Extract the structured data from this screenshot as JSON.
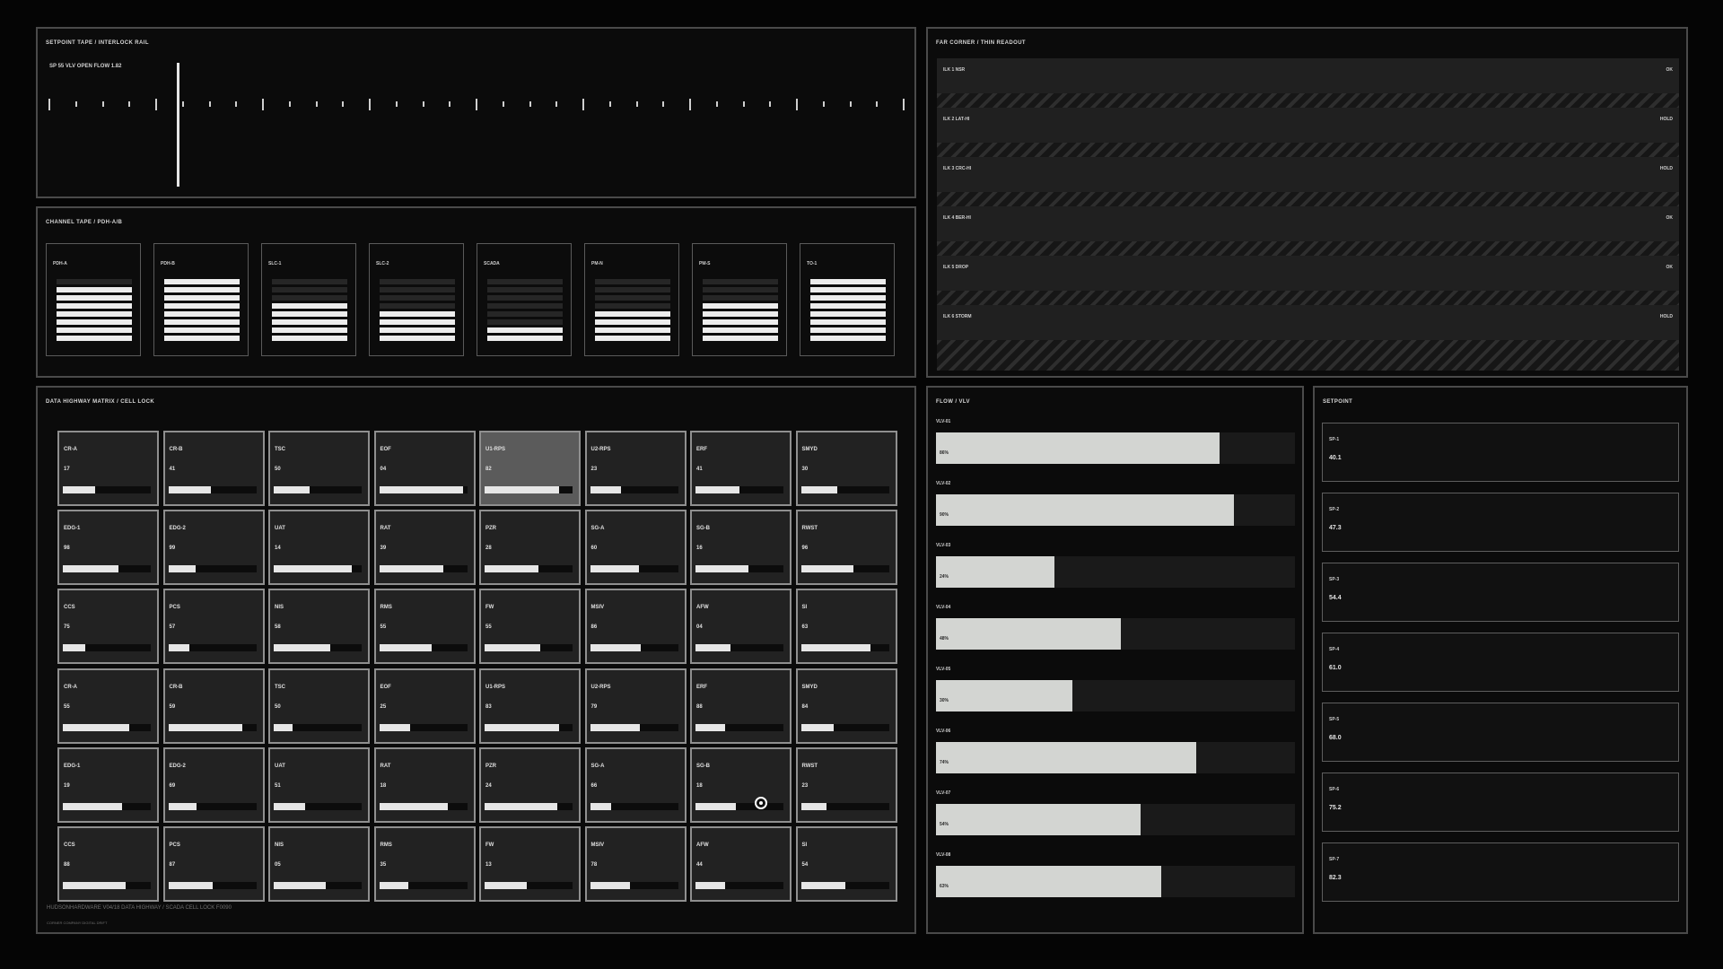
{
  "tape": {
    "title": "SETPOINT TAPE  /  INTERLOCK RAIL",
    "readout": "SP  55  VLV OPEN  FLOW 1.82"
  },
  "channel": {
    "title": "CHANNEL TAPE  /  PDH-A/B",
    "cards": [
      {
        "label": "PDH-A",
        "active": 7
      },
      {
        "label": "PDH-B",
        "active": 8
      },
      {
        "label": "SLC-1",
        "active": 5
      },
      {
        "label": "SLC-2",
        "active": 4
      },
      {
        "label": "SCADA",
        "active": 2
      },
      {
        "label": "PM-N",
        "active": 4
      },
      {
        "label": "PM-S",
        "active": 5
      },
      {
        "label": "TO-1",
        "active": 8
      }
    ]
  },
  "far": {
    "title": "FAR CORNER  /  THIN READOUT",
    "rows": [
      {
        "name": "ILK 1 NSR",
        "state": "OK"
      },
      {
        "name": "ILK 2 LAT-HI",
        "state": "HOLD"
      },
      {
        "name": "ILK 3 CRC-HI",
        "state": "HOLD"
      },
      {
        "name": "ILK 4 BER-HI",
        "state": "OK"
      },
      {
        "name": "ILK 5 DROP",
        "state": "OK"
      },
      {
        "name": "ILK 6 STORM",
        "state": "HOLD"
      }
    ]
  },
  "matrix": {
    "title": "DATA HIGHWAY MATRIX  /  CELL LOCK",
    "footer": "HUDSONHARDWARE  V04/18  DATA HIGHWAY / SCADA CELL LOCK  F0090",
    "footer2": "CORNER COMPANY  DIGITAL DRIFT",
    "cells": [
      {
        "label": "CR-A",
        "value": "17",
        "fill": 0.37
      },
      {
        "label": "CR-B",
        "value": "41",
        "fill": 0.48
      },
      {
        "label": "TSC",
        "value": "50",
        "fill": 0.41
      },
      {
        "label": "EOF",
        "value": "04",
        "fill": 0.95
      },
      {
        "label": "U1-RPS",
        "value": "82",
        "fill": 0.85,
        "highlight": true
      },
      {
        "label": "U2-RPS",
        "value": "23",
        "fill": 0.35
      },
      {
        "label": "ERF",
        "value": "41",
        "fill": 0.5
      },
      {
        "label": "SMYD",
        "value": "30",
        "fill": 0.41
      },
      {
        "label": "EDG-1",
        "value": "98",
        "fill": 0.63
      },
      {
        "label": "EDG-2",
        "value": "99",
        "fill": 0.31
      },
      {
        "label": "UAT",
        "value": "14",
        "fill": 0.89
      },
      {
        "label": "RAT",
        "value": "39",
        "fill": 0.73
      },
      {
        "label": "PZR",
        "value": "28",
        "fill": 0.61
      },
      {
        "label": "SG-A",
        "value": "60",
        "fill": 0.56
      },
      {
        "label": "SG-B",
        "value": "16",
        "fill": 0.6
      },
      {
        "label": "RWST",
        "value": "96",
        "fill": 0.6
      },
      {
        "label": "CCS",
        "value": "75",
        "fill": 0.25
      },
      {
        "label": "PCS",
        "value": "57",
        "fill": 0.24
      },
      {
        "label": "NIS",
        "value": "58",
        "fill": 0.64
      },
      {
        "label": "RMS",
        "value": "55",
        "fill": 0.6
      },
      {
        "label": "FW",
        "value": "55",
        "fill": 0.63
      },
      {
        "label": "MSIV",
        "value": "86",
        "fill": 0.58
      },
      {
        "label": "AFW",
        "value": "04",
        "fill": 0.4
      },
      {
        "label": "SI",
        "value": "63",
        "fill": 0.79
      },
      {
        "label": "CR-A",
        "value": "55",
        "fill": 0.76
      },
      {
        "label": "CR-B",
        "value": "59",
        "fill": 0.84
      },
      {
        "label": "TSC",
        "value": "50",
        "fill": 0.21
      },
      {
        "label": "EOF",
        "value": "25",
        "fill": 0.35
      },
      {
        "label": "U1-RPS",
        "value": "83",
        "fill": 0.85
      },
      {
        "label": "U2-RPS",
        "value": "79",
        "fill": 0.57
      },
      {
        "label": "ERF",
        "value": "88",
        "fill": 0.34
      },
      {
        "label": "SMYD",
        "value": "84",
        "fill": 0.37
      },
      {
        "label": "EDG-1",
        "value": "19",
        "fill": 0.67
      },
      {
        "label": "EDG-2",
        "value": "69",
        "fill": 0.32
      },
      {
        "label": "UAT",
        "value": "51",
        "fill": 0.36
      },
      {
        "label": "RAT",
        "value": "18",
        "fill": 0.78
      },
      {
        "label": "PZR",
        "value": "24",
        "fill": 0.83
      },
      {
        "label": "SG-A",
        "value": "66",
        "fill": 0.24
      },
      {
        "label": "SG-B",
        "value": "18",
        "fill": 0.46,
        "target": true
      },
      {
        "label": "RWST",
        "value": "23",
        "fill": 0.29
      },
      {
        "label": "CCS",
        "value": "88",
        "fill": 0.71
      },
      {
        "label": "PCS",
        "value": "87",
        "fill": 0.5
      },
      {
        "label": "NIS",
        "value": "05",
        "fill": 0.59
      },
      {
        "label": "RMS",
        "value": "35",
        "fill": 0.33
      },
      {
        "label": "FW",
        "value": "13",
        "fill": 0.48
      },
      {
        "label": "MSIV",
        "value": "78",
        "fill": 0.45
      },
      {
        "label": "AFW",
        "value": "44",
        "fill": 0.34
      },
      {
        "label": "SI",
        "value": "54",
        "fill": 0.5
      }
    ]
  },
  "flow": {
    "title": "FLOW  /  VLV",
    "items": [
      {
        "label": "VLV-01",
        "pct": "86%",
        "value": 0.79
      },
      {
        "label": "VLV-02",
        "pct": "90%",
        "value": 0.83
      },
      {
        "label": "VLV-03",
        "pct": "24%",
        "value": 0.33
      },
      {
        "label": "VLV-04",
        "pct": "48%",
        "value": 0.515
      },
      {
        "label": "VLV-05",
        "pct": "30%",
        "value": 0.38
      },
      {
        "label": "VLV-06",
        "pct": "74%",
        "value": 0.725
      },
      {
        "label": "VLV-07",
        "pct": "54%",
        "value": 0.57
      },
      {
        "label": "VLV-08",
        "pct": "63%",
        "value": 0.627
      }
    ]
  },
  "setpoint": {
    "title": "SETPOINT",
    "items": [
      {
        "label": "SP-1",
        "value": "40.1"
      },
      {
        "label": "SP-2",
        "value": "47.3"
      },
      {
        "label": "SP-3",
        "value": "54.4"
      },
      {
        "label": "SP-4",
        "value": "61.0"
      },
      {
        "label": "SP-5",
        "value": "68.0"
      },
      {
        "label": "SP-6",
        "value": "75.2"
      },
      {
        "label": "SP-7",
        "value": "82.3"
      }
    ]
  },
  "colors": {
    "background": "#050505",
    "panel_border": "#4a4a4a",
    "accent": "#e6e6e6"
  }
}
